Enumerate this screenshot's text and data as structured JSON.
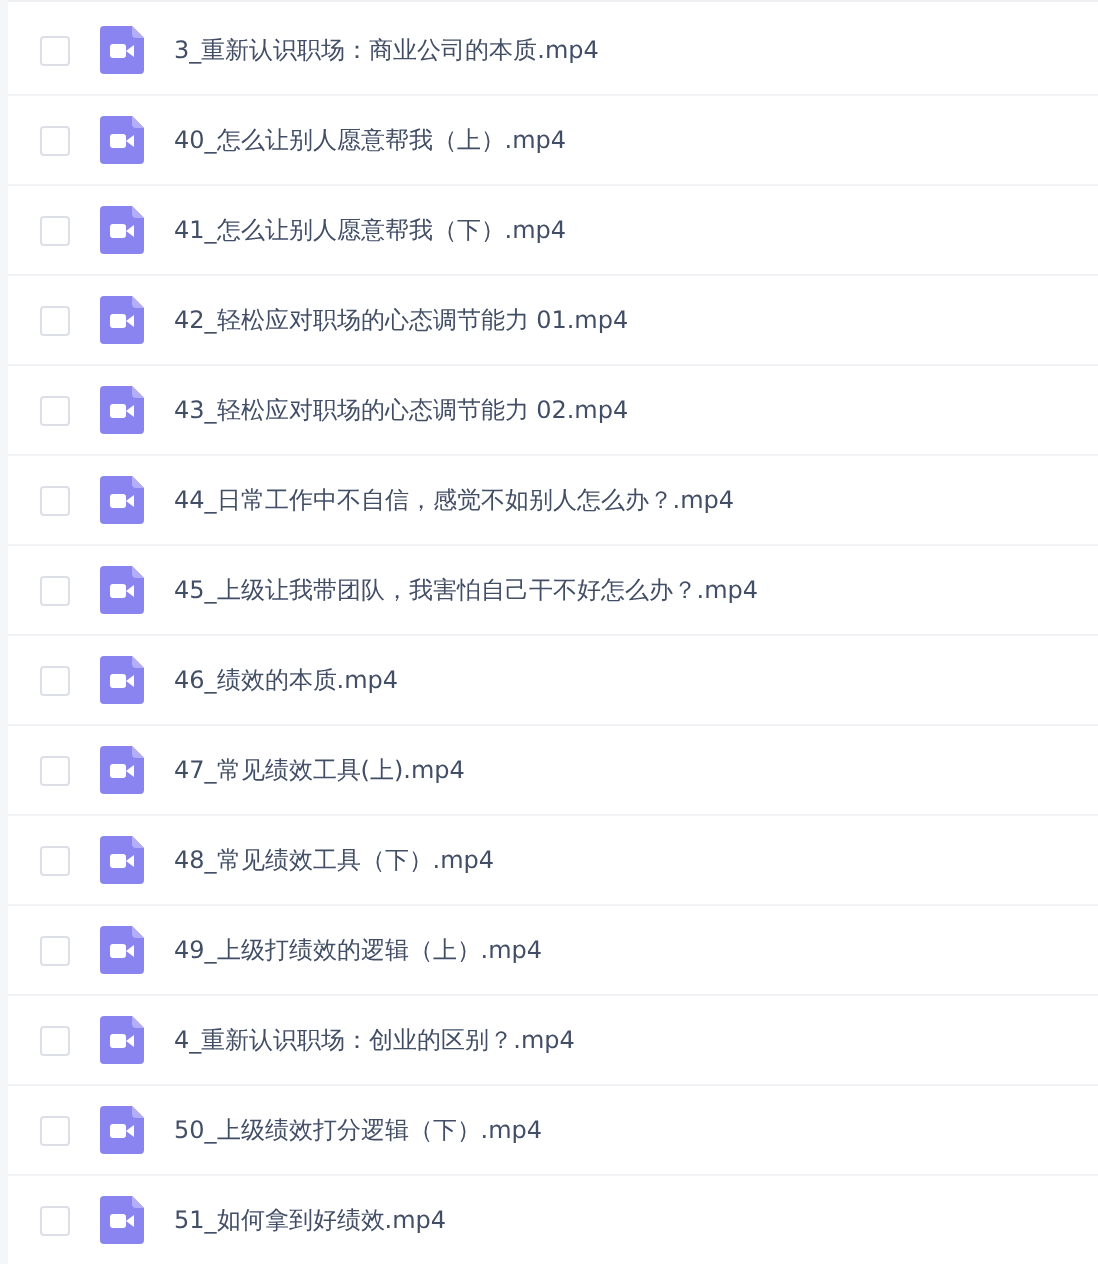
{
  "files": [
    {
      "name": "3_重新认识职场：商业公司的本质.mp4",
      "checked": false
    },
    {
      "name": "40_怎么让别人愿意帮我（上）.mp4",
      "checked": false
    },
    {
      "name": "41_怎么让别人愿意帮我（下）.mp4",
      "checked": false
    },
    {
      "name": "42_轻松应对职场的心态调节能力 01.mp4",
      "checked": false
    },
    {
      "name": "43_轻松应对职场的心态调节能力 02.mp4",
      "checked": false
    },
    {
      "name": "44_日常工作中不自信，感觉不如别人怎么办？.mp4",
      "checked": false
    },
    {
      "name": "45_上级让我带团队，我害怕自己干不好怎么办？.mp4",
      "checked": false
    },
    {
      "name": "46_绩效的本质.mp4",
      "checked": false
    },
    {
      "name": "47_常见绩效工具(上).mp4",
      "checked": false
    },
    {
      "name": "48_常见绩效工具（下）.mp4",
      "checked": false
    },
    {
      "name": "49_上级打绩效的逻辑（上）.mp4",
      "checked": false
    },
    {
      "name": "4_重新认识职场：创业的区别？.mp4",
      "checked": false
    },
    {
      "name": "50_上级绩效打分逻辑（下）.mp4",
      "checked": false
    },
    {
      "name": "51_如何拿到好绩效.mp4",
      "checked": false
    }
  ]
}
